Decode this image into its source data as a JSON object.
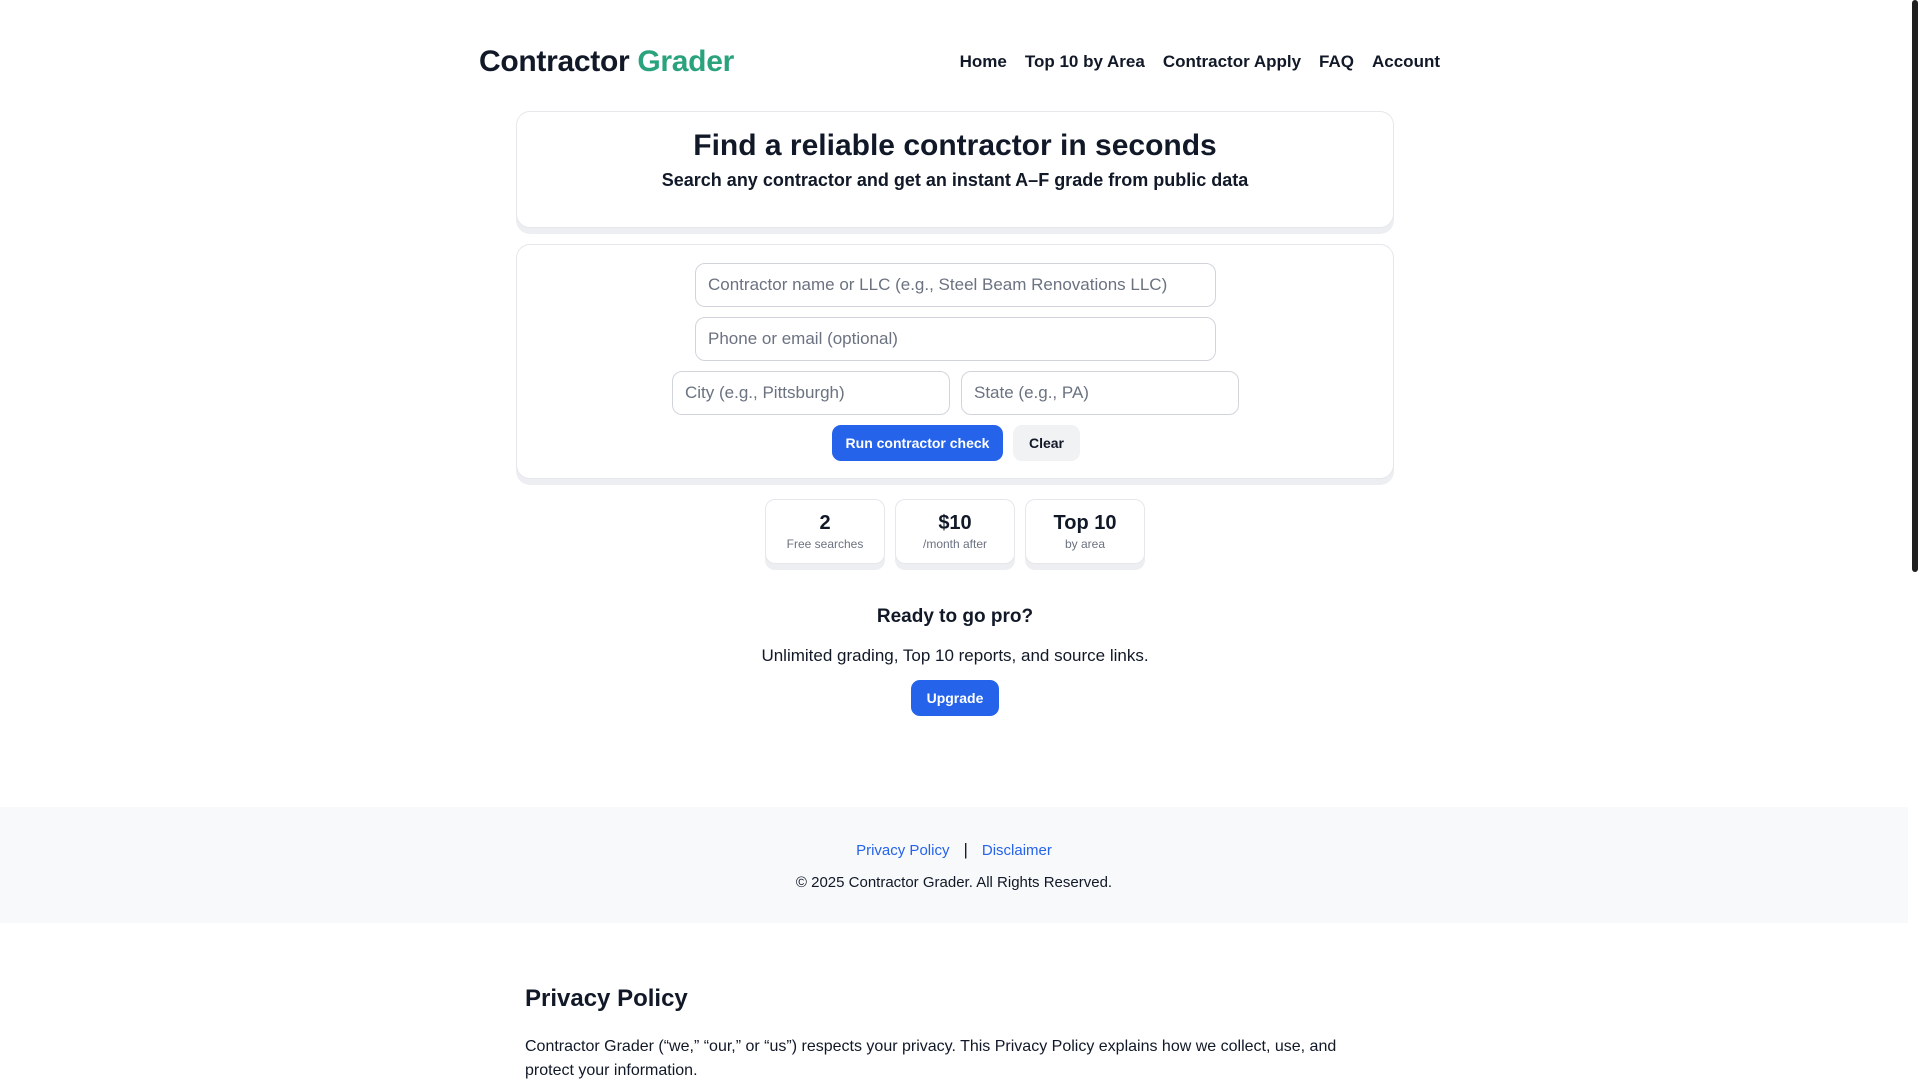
{
  "header": {
    "brand_primary": "Contractor",
    "brand_accent": "Grader",
    "nav": [
      "Home",
      "Top 10 by Area",
      "Contractor Apply",
      "FAQ",
      "Account"
    ]
  },
  "hero": {
    "title": "Find a reliable contractor in seconds",
    "subtitle": "Search any contractor and get an instant A–F grade from public data"
  },
  "form": {
    "name_placeholder": "Contractor name or LLC (e.g., Steel Beam Renovations LLC)",
    "contact_placeholder": "Phone or email (optional)",
    "city_placeholder": "City (e.g., Pittsburgh)",
    "state_placeholder": "State (e.g., PA)",
    "run_label": "Run contractor check",
    "clear_label": "Clear"
  },
  "stats": [
    {
      "value": "2",
      "label": "Free searches"
    },
    {
      "value": "$10",
      "label": "/month after"
    },
    {
      "value": "Top 10",
      "label": "by area"
    }
  ],
  "pro": {
    "title": "Ready to go pro?",
    "text": "Unlimited grading, Top 10 reports, and source links.",
    "upgrade_label": "Upgrade"
  },
  "footer": {
    "privacy_label": "Privacy Policy",
    "separator": "|",
    "disclaimer_label": "Disclaimer",
    "copyright": "© 2025 Contractor Grader. All Rights Reserved."
  },
  "privacy": {
    "title": "Privacy Policy",
    "text": "Contractor Grader (“we,” “our,” or “us”) respects your privacy. This Privacy Policy explains how we collect, use, and protect your information."
  },
  "colors": {
    "accent_green": "#2aa37d",
    "primary_blue": "#2563eb"
  }
}
